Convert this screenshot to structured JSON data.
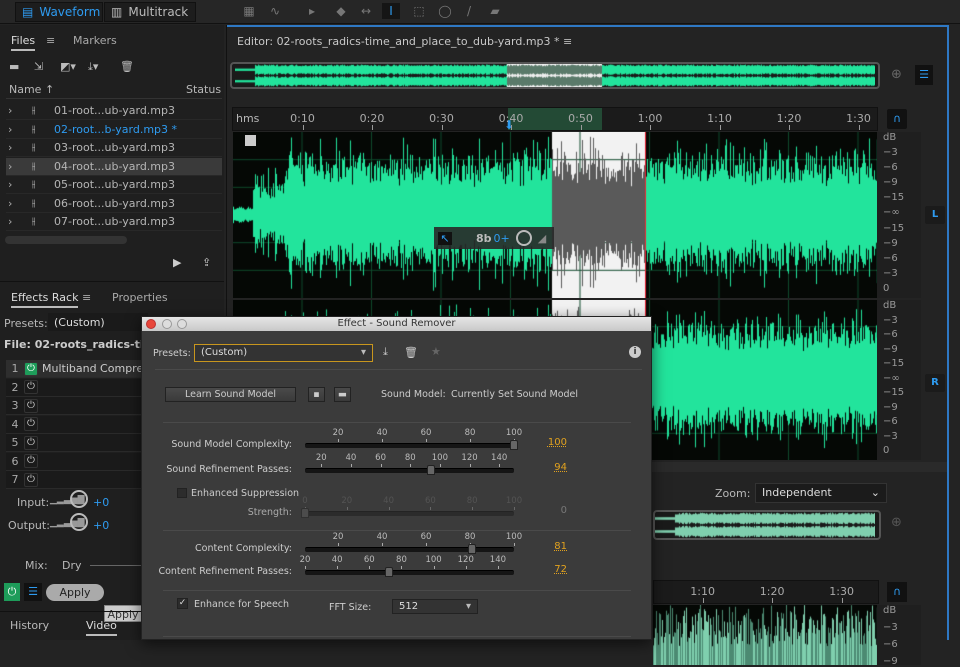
{
  "modes": [
    {
      "label": "Waveform",
      "active": true
    },
    {
      "label": "Multitrack",
      "active": false
    }
  ],
  "files_panel": {
    "tabs": [
      "Files",
      "Markers"
    ],
    "columns": {
      "name": "Name",
      "status": "Status"
    },
    "files": [
      "01-root...ub-yard.mp3",
      "02-root...b-yard.mp3 *",
      "03-root...ub-yard.mp3",
      "04-root...ub-yard.mp3",
      "05-root...ub-yard.mp3",
      "06-root...ub-yard.mp3",
      "07-root...ub-yard.mp3"
    ]
  },
  "effects_panel": {
    "tabs": [
      "Effects Rack",
      "Properties"
    ],
    "presets_label": "Presets:",
    "presets_value": "(Custom)",
    "file_label": "File: 02-roots_radics-tim",
    "rack": [
      {
        "n": "1",
        "name": "Multiband Compre",
        "on": true
      },
      {
        "n": "2",
        "name": ""
      },
      {
        "n": "3",
        "name": ""
      },
      {
        "n": "4",
        "name": ""
      },
      {
        "n": "5",
        "name": ""
      },
      {
        "n": "6",
        "name": ""
      },
      {
        "n": "7",
        "name": ""
      }
    ],
    "input_label": "Input:",
    "input_value": "+0",
    "output_label": "Output:",
    "output_value": "+0",
    "mix_label": "Mix:",
    "mix_value": "Dry",
    "apply": "Apply",
    "apply_tooltip": "Apply",
    "bottom_tabs": [
      "History",
      "Video"
    ]
  },
  "editor": {
    "title": "Editor: 02-roots_radics-time_and_place_to_dub-yard.mp3 *",
    "ruler_unit": "hms",
    "ruler": [
      {
        "t": 10,
        "l": "0:10"
      },
      {
        "t": 20,
        "l": "0:20"
      },
      {
        "t": 30,
        "l": "0:30"
      },
      {
        "t": 40,
        "l": "0:40"
      },
      {
        "t": 50,
        "l": "0:50"
      },
      {
        "t": 60,
        "l": "1:00"
      },
      {
        "t": 70,
        "l": "1:10"
      },
      {
        "t": 80,
        "l": "1:20"
      },
      {
        "t": 90,
        "l": "1:30"
      }
    ],
    "db_scale": [
      "dB",
      "−3",
      "−6",
      "−9",
      "−15",
      "−∞",
      "−15",
      "−9",
      "−6",
      "−3",
      "0"
    ],
    "channels": [
      "L",
      "R"
    ],
    "hud": {
      "bits": "8b",
      "gain": "0+"
    },
    "zoom_label": "Zoom:",
    "zoom_value": "Independent",
    "lower_ruler": [
      {
        "t": 70,
        "l": "1:10"
      },
      {
        "t": 80,
        "l": "1:20"
      },
      {
        "t": 90,
        "l": "1:30"
      }
    ],
    "lower_db": [
      "dB",
      "−3",
      "−6",
      "−9"
    ]
  },
  "dialog": {
    "title": "Effect - Sound Remover",
    "presets_label": "Presets:",
    "presets_value": "(Custom)",
    "learn": "Learn Sound Model",
    "model_label": "Sound Model:",
    "model_value": "Currently Set Sound Model",
    "sliders": [
      {
        "label": "Sound Model Complexity:",
        "min": 5,
        "max": 100,
        "ticks": [
          20,
          40,
          60,
          80,
          100
        ],
        "value": 100,
        "display": "100"
      },
      {
        "label": "Sound Refinement Passes:",
        "min": 9,
        "max": 150,
        "ticks": [
          20,
          40,
          60,
          80,
          100,
          120,
          140
        ],
        "value": 94,
        "display": "94"
      },
      {
        "label": "Strength:",
        "min": 0,
        "max": 100,
        "ticks": [
          0,
          20,
          40,
          60,
          80,
          100
        ],
        "value": 0,
        "display": "0",
        "disabled": true
      },
      {
        "label": "Content Complexity:",
        "min": 5,
        "max": 100,
        "ticks": [
          20,
          40,
          60,
          80,
          100
        ],
        "value": 81,
        "display": "81"
      },
      {
        "label": "Content Refinement Passes:",
        "min": 20,
        "max": 150,
        "ticks": [
          20,
          40,
          60,
          80,
          100,
          120,
          140
        ],
        "value": 72,
        "display": "72"
      }
    ],
    "enhanced_suppression": {
      "label": "Enhanced Suppression",
      "checked": false
    },
    "enhance_speech": {
      "label": "Enhance for Speech",
      "checked": true
    },
    "fft_label": "FFT Size:",
    "fft_value": "512"
  },
  "colors": {
    "accent": "#2e9bf0",
    "waveform": "#22e49c",
    "value": "#e2a21e"
  }
}
